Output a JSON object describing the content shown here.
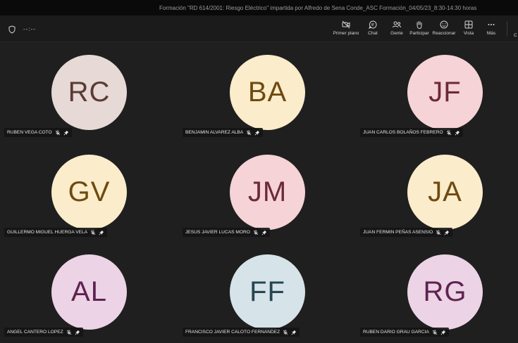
{
  "window": {
    "title": "Formación \"RD 614/2001: Riesgo Eléctrico\" impartida por Alfredo de Sena Conde_ASC Formación_04/05/23_8:30-14:30 horas"
  },
  "toolbar": {
    "timer": "--:--",
    "buttons": [
      {
        "id": "primer-plano",
        "label": "Primer plano",
        "icon": "camera-off-icon"
      },
      {
        "id": "chat",
        "label": "Chat",
        "icon": "chat-icon"
      },
      {
        "id": "gente",
        "label": "Gente",
        "icon": "people-icon"
      },
      {
        "id": "participar",
        "label": "Participar",
        "icon": "raise-hand-icon"
      },
      {
        "id": "reaccionar",
        "label": "Reaccionar",
        "icon": "smiley-icon"
      },
      {
        "id": "vista",
        "label": "Vista",
        "icon": "grid-view-icon"
      },
      {
        "id": "mas",
        "label": "Más",
        "icon": "more-icon"
      }
    ],
    "cut_label": "C"
  },
  "participants": [
    {
      "initials": "RC",
      "name": "RUBEN VEGA COTO",
      "bg": "#e6d9d6",
      "fg": "#5a3b33"
    },
    {
      "initials": "BA",
      "name": "BENJAMIN ALVAREZ ALBA",
      "bg": "#fbeccb",
      "fg": "#6e4a10"
    },
    {
      "initials": "JF",
      "name": "JUAN CARLOS BOLAÑOS FEBRERO",
      "bg": "#f6d3d6",
      "fg": "#6b2a36"
    },
    {
      "initials": "GV",
      "name": "GUILLERMO MIGUEL HUERGA VELA",
      "bg": "#fbeccb",
      "fg": "#6e4a10"
    },
    {
      "initials": "JM",
      "name": "JESUS JAVIER LUCAS MORO",
      "bg": "#f6d3d6",
      "fg": "#6b2a36"
    },
    {
      "initials": "JA",
      "name": "JUAN FERMIN PEÑAS ASENSIO",
      "bg": "#fbeccb",
      "fg": "#6e4a10"
    },
    {
      "initials": "AL",
      "name": "ANGEL CANTERO LOPEZ",
      "bg": "#ecd3e6",
      "fg": "#5e2350"
    },
    {
      "initials": "FF",
      "name": "FRANCISCO JAVIER CALOTO FERNANDEZ",
      "bg": "#d6e3e8",
      "fg": "#274552"
    },
    {
      "initials": "RG",
      "name": "RUBEN DARIO GRAU GARCIA",
      "bg": "#ecd3e6",
      "fg": "#5e2350"
    }
  ]
}
